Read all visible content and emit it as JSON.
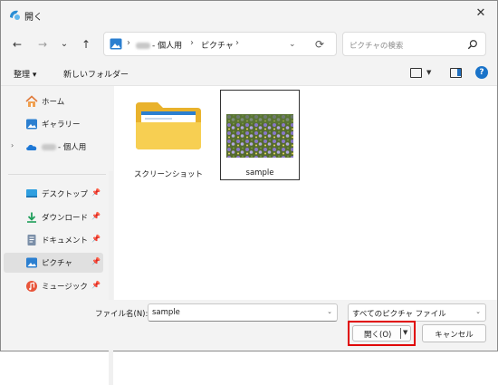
{
  "window": {
    "title": "開く",
    "close": "✕"
  },
  "nav": {
    "back": "←",
    "forward": "→",
    "recent": "⌄",
    "up": "↑",
    "breadcrumbs": [
      "個人用",
      "ピクチャ"
    ],
    "breadcrumb_prefix": "- ",
    "refresh": "⟳"
  },
  "search": {
    "placeholder": "ピクチャの検索",
    "icon": "search-icon"
  },
  "commandbar": {
    "organize": "整理 ▾",
    "new_folder": "新しいフォルダー"
  },
  "sidebar": {
    "items": [
      {
        "label": "ホーム",
        "icon": "home-icon"
      },
      {
        "label": "ギャラリー",
        "icon": "gallery-icon"
      },
      {
        "label": "- 個人用",
        "icon": "cloud-icon"
      },
      {
        "label": "デスクトップ",
        "icon": "desktop-icon",
        "pinned": true
      },
      {
        "label": "ダウンロード",
        "icon": "download-icon",
        "pinned": true
      },
      {
        "label": "ドキュメント",
        "icon": "document-icon",
        "pinned": true
      },
      {
        "label": "ピクチャ",
        "icon": "pictures-icon",
        "pinned": true,
        "selected": true
      },
      {
        "label": "ミュージック",
        "icon": "music-icon",
        "pinned": true
      }
    ]
  },
  "files": [
    {
      "name": "スクリーンショット",
      "type": "folder"
    },
    {
      "name": "sample",
      "type": "image",
      "selected": true
    }
  ],
  "bottom": {
    "filename_label": "ファイル名(N):",
    "filename_value": "sample",
    "filetype": "すべてのピクチャ ファイル",
    "open_label": "開く(O)",
    "cancel_label": "キャンセル"
  },
  "colors": {
    "accent": "#1a73c9",
    "highlight_border": "#e00000",
    "folder": "#f4c63a"
  }
}
